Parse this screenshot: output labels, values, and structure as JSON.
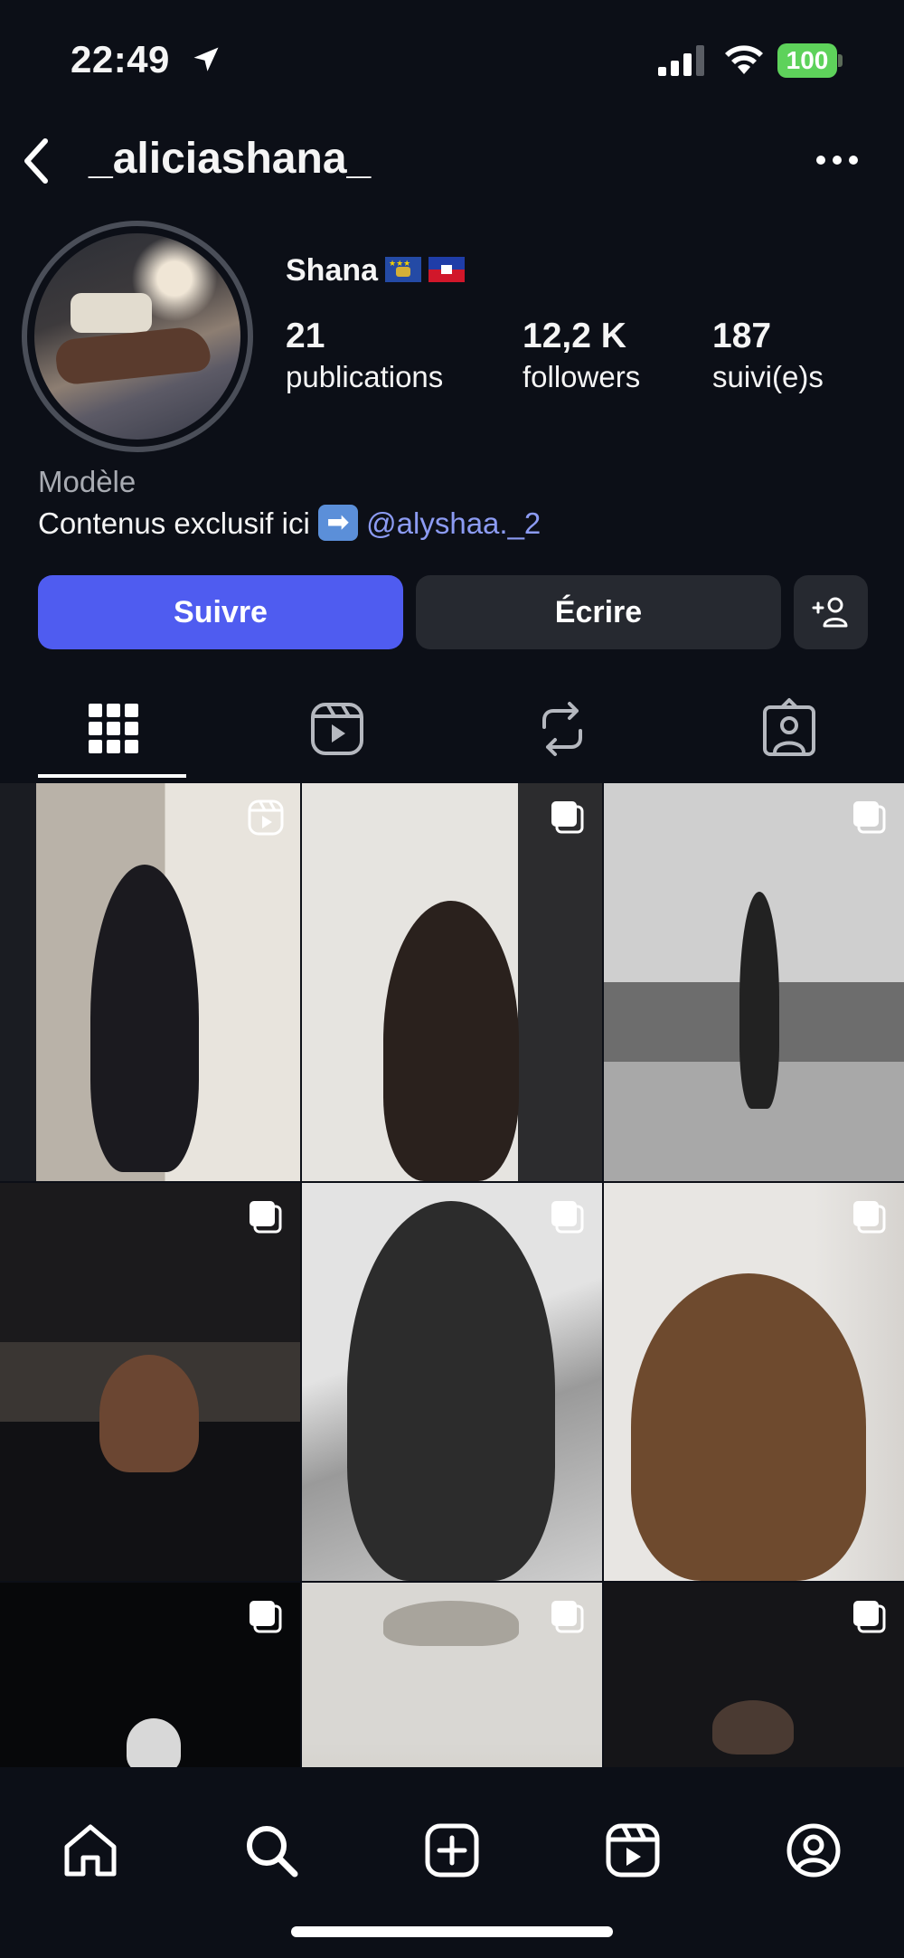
{
  "status_bar": {
    "time": "22:49",
    "battery": "100"
  },
  "header": {
    "username": "_aliciashana_"
  },
  "profile": {
    "display_name": "Shana",
    "stats": [
      {
        "value": "21",
        "label": "publications"
      },
      {
        "value": "12,2 K",
        "label": "followers"
      },
      {
        "value": "187",
        "label": "suivi(e)s"
      }
    ],
    "category": "Modèle",
    "bio_text": "Contenus exclusif ici",
    "bio_emoji": "➡",
    "bio_mention": "@alyshaa._2"
  },
  "actions": {
    "follow": "Suivre",
    "message": "Écrire"
  },
  "tabs": [
    "grid-icon",
    "reels-icon",
    "repost-icon",
    "tagged-icon"
  ],
  "grid": {
    "posts": [
      {
        "type": "reel"
      },
      {
        "type": "carousel"
      },
      {
        "type": "carousel"
      },
      {
        "type": "carousel"
      },
      {
        "type": "carousel"
      },
      {
        "type": "carousel"
      },
      {
        "type": "carousel"
      },
      {
        "type": "carousel"
      },
      {
        "type": "carousel"
      }
    ]
  },
  "bottom_nav": [
    "home-icon",
    "search-icon",
    "create-icon",
    "reels-icon",
    "profile-icon"
  ],
  "colors": {
    "accent": "#4f5cf0",
    "background": "#0c0f17",
    "secondary_button": "#262930",
    "mention": "#8c9bf3",
    "battery": "#5ed25b"
  }
}
